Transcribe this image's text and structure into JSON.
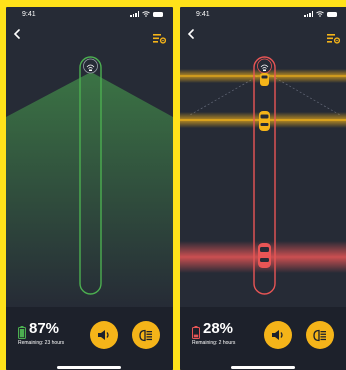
{
  "colors": {
    "background": "#FFE21A",
    "screen": "#262B36",
    "bottom_bar": "#1D212B",
    "accent": "#F5B419",
    "safe": "#4CAF50",
    "danger": "#E85555",
    "warning": "#F5B419"
  },
  "screens": [
    {
      "id": "safe",
      "status": {
        "time": "9:41"
      },
      "back_icon": "chevron-left-icon",
      "settings_icon": "sliders-gear-icon",
      "sensor_state": "clear",
      "battery": {
        "percent": "87%",
        "remaining": "Remaining: 23 hours",
        "level": 0.87
      },
      "horn_icon": "speaker-icon",
      "lights_icon": "headlight-icon"
    },
    {
      "id": "alert",
      "status": {
        "time": "9:41"
      },
      "back_icon": "chevron-left-icon",
      "settings_icon": "sliders-gear-icon",
      "sensor_state": "obstacles-detected",
      "battery": {
        "percent": "28%",
        "remaining": "Remaining: 2 hours",
        "level": 0.28
      },
      "horn_icon": "speaker-icon",
      "lights_icon": "headlight-icon"
    }
  ]
}
